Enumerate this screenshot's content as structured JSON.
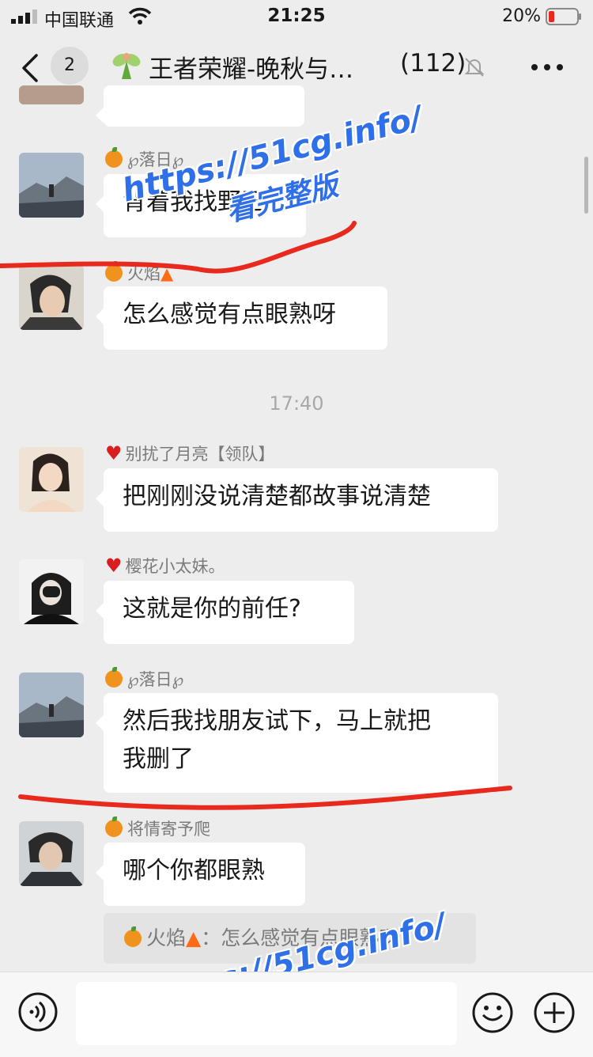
{
  "status_bar": {
    "carrier": "中国联通",
    "time": "21:25",
    "battery": "20%"
  },
  "header": {
    "unread_count": "2",
    "title": "王者荣耀-晚秋与…",
    "member_count": "(112)"
  },
  "messages": [
    {
      "sender": "℘落日℘",
      "text": "背着我找野王"
    },
    {
      "sender": "火焰",
      "text": "怎么感觉有点眼熟呀"
    },
    {
      "sender": "别扰了月亮【领队】",
      "text": "把刚刚没说清楚都故事说清楚"
    },
    {
      "sender": "樱花小太妹。",
      "text": "这就是你的前任?"
    },
    {
      "sender": "℘落日℘",
      "text": "然后我找朋友试下，马上就把\n我删了"
    },
    {
      "sender": "将情寄予爬",
      "text": "哪个你都眼熟"
    }
  ],
  "timestamp": "17:40",
  "quote": {
    "sender": "火焰",
    "separator": "：",
    "text": "怎么感觉有点眼熟呀"
  },
  "watermark": {
    "url": "https://51cg.info/",
    "text": "看完整版"
  },
  "colors": {
    "background": "#ededed",
    "bubble": "#ffffff",
    "annotation_line": "#e8291d",
    "watermark": "#2f6fe8"
  }
}
